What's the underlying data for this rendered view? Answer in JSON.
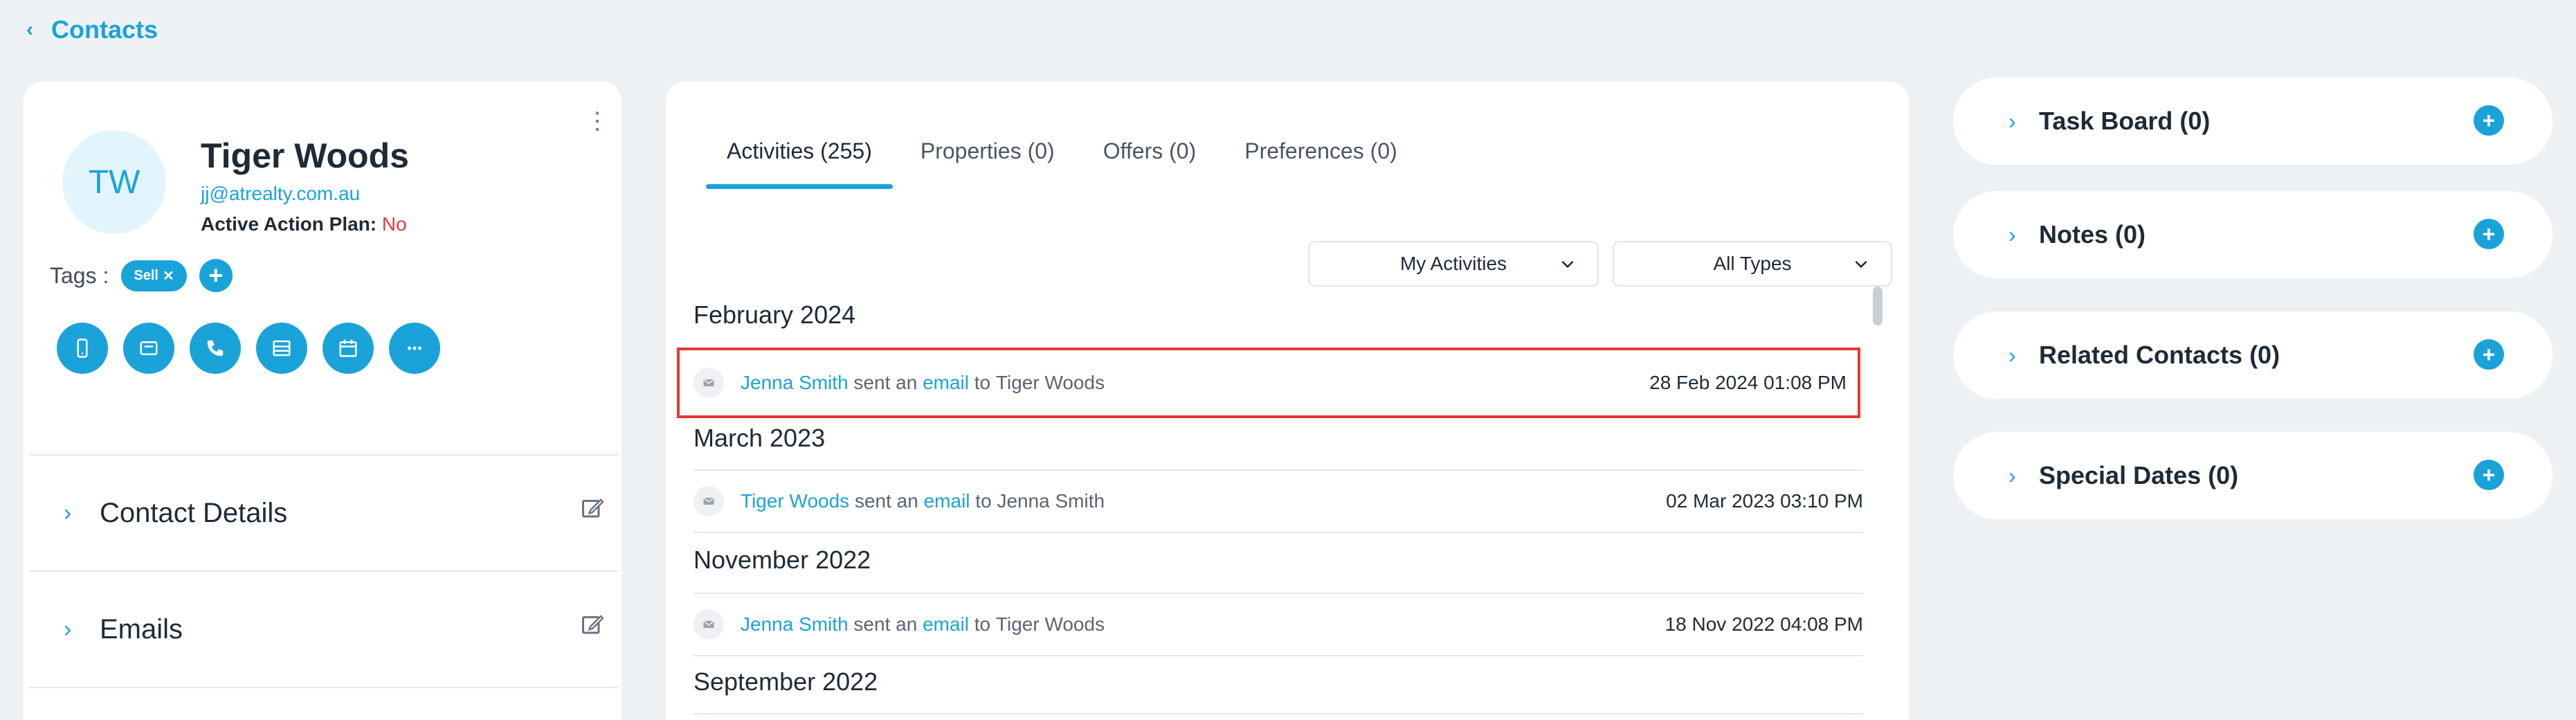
{
  "nav": {
    "back_label": "Contacts"
  },
  "contact": {
    "initials": "TW",
    "name": "Tiger Woods",
    "email": "jj@atrealty.com.au",
    "action_plan_label": "Active Action Plan:",
    "action_plan_value": "No",
    "tags_label": "Tags :",
    "tags": [
      "Sell"
    ],
    "action_buttons": [
      "phone-icon",
      "message-icon",
      "call-icon",
      "list-icon",
      "calendar-icon",
      "more-icon"
    ]
  },
  "sections": [
    {
      "title": "Contact Details"
    },
    {
      "title": "Emails"
    }
  ],
  "tabs": [
    {
      "label": "Activities (255)",
      "active": true
    },
    {
      "label": "Properties (0)"
    },
    {
      "label": "Offers (0)"
    },
    {
      "label": "Preferences (0)"
    }
  ],
  "filters": {
    "owner": "My Activities",
    "type": "All Types"
  },
  "activity_groups": [
    {
      "month": "February 2024",
      "items": [
        {
          "actor": "Jenna Smith",
          "verb": "sent an",
          "object": "email",
          "prep": "to",
          "target": "Tiger Woods",
          "date": "28 Feb 2024 01:08 PM",
          "selected": true
        }
      ]
    },
    {
      "month": "March 2023",
      "items": [
        {
          "actor": "Tiger Woods",
          "verb": "sent an",
          "object": "email",
          "prep": "to",
          "target": "Jenna Smith",
          "date": "02 Mar 2023 03:10 PM"
        }
      ]
    },
    {
      "month": "November 2022",
      "items": [
        {
          "actor": "Jenna Smith",
          "verb": "sent an",
          "object": "email",
          "prep": "to",
          "target": "Tiger Woods",
          "date": "18 Nov 2022 04:08 PM"
        }
      ]
    },
    {
      "month": "September 2022",
      "items": []
    }
  ],
  "right_cards": [
    {
      "title": "Task Board (0)"
    },
    {
      "title": "Notes (0)"
    },
    {
      "title": "Related Contacts (0)"
    },
    {
      "title": "Special Dates (0)"
    }
  ],
  "colors": {
    "accent": "#1aa3d9",
    "danger": "#e53935",
    "background": "#eef1f3"
  }
}
